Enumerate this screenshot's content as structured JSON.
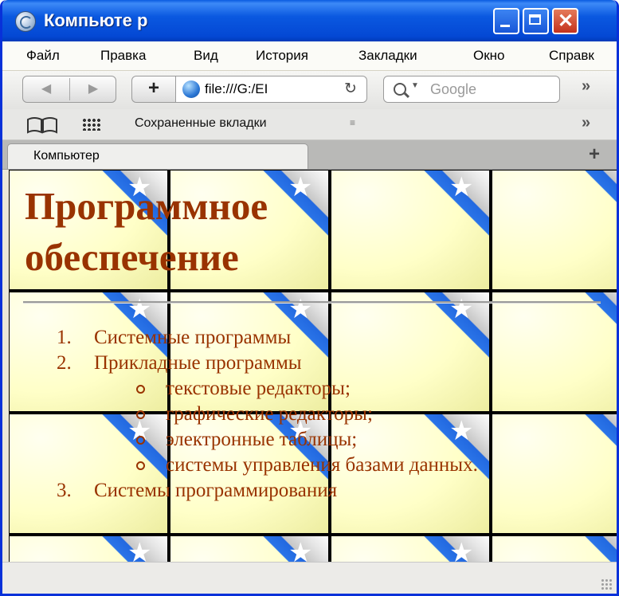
{
  "window": {
    "title": "Компьюте р"
  },
  "menu": [
    "Файл",
    "Правка",
    "Вид",
    "История",
    "Закладки",
    "Окно",
    "Справк"
  ],
  "toolbar": {
    "back": "◀",
    "forward": "▶",
    "add": "+",
    "url": "file:///G:/EI",
    "reload": "↻",
    "search_placeholder": "Google",
    "overflow": "»"
  },
  "bookmarks": {
    "label": "Сохраненные вкладки",
    "overflow": "»"
  },
  "tabs": [
    {
      "label": "Компьютер"
    }
  ],
  "page": {
    "title_line1": "Программное",
    "title_line2": "обеспечение",
    "items": [
      {
        "num": "1.",
        "text": "Системные программы"
      },
      {
        "num": "2.",
        "text": "Прикладные программы",
        "subitems": [
          "текстовые редакторы;",
          "графические редакторы;",
          "электронные таблицы;",
          "системы управления базами данных."
        ]
      },
      {
        "num": "3.",
        "text": "Системы программирования"
      }
    ]
  },
  "colors": {
    "titlebar": "#0a58e0",
    "heading": "#993300",
    "tile": "#ffffc8",
    "corner": "#2a74e8"
  }
}
